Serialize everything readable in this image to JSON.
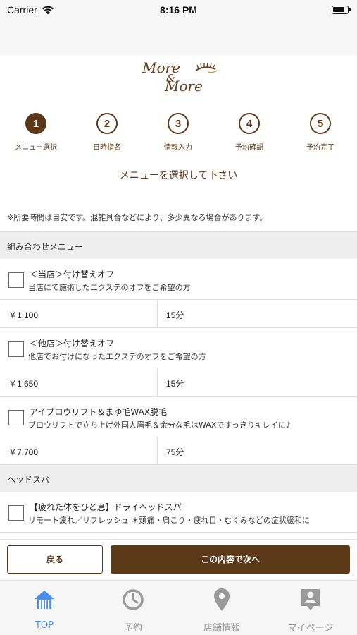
{
  "status_bar": {
    "carrier": "Carrier",
    "time": "8:16 PM"
  },
  "logo": {
    "line1": "More",
    "line2": "&",
    "line3": "More"
  },
  "steps": [
    {
      "number": "1",
      "label": "メニュー選択",
      "active": true
    },
    {
      "number": "2",
      "label": "日時指名",
      "active": false
    },
    {
      "number": "3",
      "label": "情報入力",
      "active": false
    },
    {
      "number": "4",
      "label": "予約確認",
      "active": false
    },
    {
      "number": "5",
      "label": "予約完了",
      "active": false
    }
  ],
  "heading": "メニューを選択して下さい",
  "notice": "※所要時間は目安です。混雑具合などにより、多少異なる場合があります。",
  "sections": [
    {
      "title": "組み合わせメニュー",
      "items": [
        {
          "name": "＜当店＞付け替えオフ",
          "description": "当店にて施術したエクステのオフをご希望の方",
          "price": "￥1,100",
          "duration": "15分"
        },
        {
          "name": "＜他店＞付け替えオフ",
          "description": "他店でお付けになったエクステのオフをご希望の方",
          "price": "￥1,650",
          "duration": "15分"
        },
        {
          "name": "アイブロウリフト＆まゆ毛WAX脱毛",
          "description": "ブロウリフトで立ち上げ外国人眉毛＆余分な毛はWAXですっきりキレイに♪",
          "price": "￥7,700",
          "duration": "75分"
        }
      ]
    },
    {
      "title": "ヘッドスパ",
      "items": [
        {
          "name": "【疲れた体をひと息】ドライヘッドスパ",
          "description": "リモート疲れ／リフレッシュ ＊頭痛・肩こり・疲れ目・むくみなどの症状緩和に"
        }
      ]
    }
  ],
  "buttons": {
    "back": "戻る",
    "next": "この内容で次へ"
  },
  "tabbar": [
    {
      "label": "TOP",
      "icon": "home-icon",
      "active": true
    },
    {
      "label": "予約",
      "icon": "clock-icon",
      "active": false
    },
    {
      "label": "店舗情報",
      "icon": "location-pin-icon",
      "active": false
    },
    {
      "label": "マイページ",
      "icon": "person-badge-icon",
      "active": false
    }
  ],
  "colors": {
    "brand_brown": "#5a3818",
    "tab_active": "#4a8df0",
    "tab_inactive": "#9a9a9a",
    "section_bg": "#eeeeee"
  }
}
